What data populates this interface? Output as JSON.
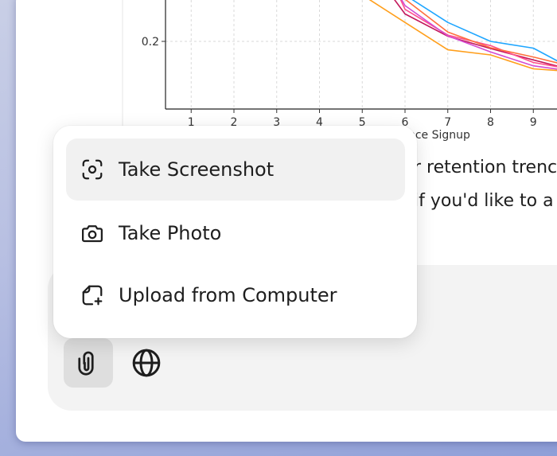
{
  "chat": {
    "lines": [
      "r retention trenc",
      "if you'd like to a"
    ]
  },
  "attach_menu": {
    "items": [
      {
        "label": "Take Screenshot",
        "icon": "screenshot-icon"
      },
      {
        "label": "Take Photo",
        "icon": "camera-icon"
      },
      {
        "label": "Upload from Computer",
        "icon": "upload-file-icon"
      }
    ]
  },
  "composer": {
    "tools": [
      {
        "icon": "paperclip-icon",
        "active": true
      },
      {
        "icon": "globe-icon",
        "active": false
      }
    ]
  },
  "chart_data": {
    "type": "line",
    "xlabel": "ince Signup",
    "ylabel": "",
    "x_ticks": [
      1,
      2,
      3,
      4,
      5,
      6,
      7,
      8,
      9
    ],
    "y_ticks": [
      0.2
    ],
    "xlim": [
      0.4,
      10.0
    ],
    "ylim": [
      0.1,
      0.35
    ],
    "grid": true,
    "series": [
      {
        "color": "#ff9f1c",
        "x": [
          5,
          6,
          7,
          8,
          9,
          10
        ],
        "y": [
          0.31,
          0.245,
          0.18,
          0.168,
          0.135,
          0.128
        ]
      },
      {
        "color": "#1fa6ff",
        "x": [
          6,
          7,
          8,
          9,
          10
        ],
        "y": [
          0.31,
          0.245,
          0.2,
          0.184,
          0.13
        ]
      },
      {
        "color": "#c2185b",
        "x": [
          5.6,
          6,
          7,
          8,
          9,
          10
        ],
        "y": [
          0.32,
          0.265,
          0.212,
          0.183,
          0.156,
          0.13
        ]
      },
      {
        "color": "#ff4f8b",
        "x": [
          5.8,
          6,
          7,
          8,
          9,
          10
        ],
        "y": [
          0.32,
          0.276,
          0.215,
          0.19,
          0.15,
          0.132
        ]
      },
      {
        "color": "#ff6f3c",
        "x": [
          6,
          7,
          8,
          9,
          10
        ],
        "y": [
          0.3,
          0.222,
          0.185,
          0.163,
          0.138
        ]
      },
      {
        "color": "#d34bd1",
        "x": [
          5.8,
          6,
          7,
          8,
          9,
          10
        ],
        "y": [
          0.32,
          0.285,
          0.213,
          0.175,
          0.142,
          0.128
        ]
      }
    ]
  }
}
